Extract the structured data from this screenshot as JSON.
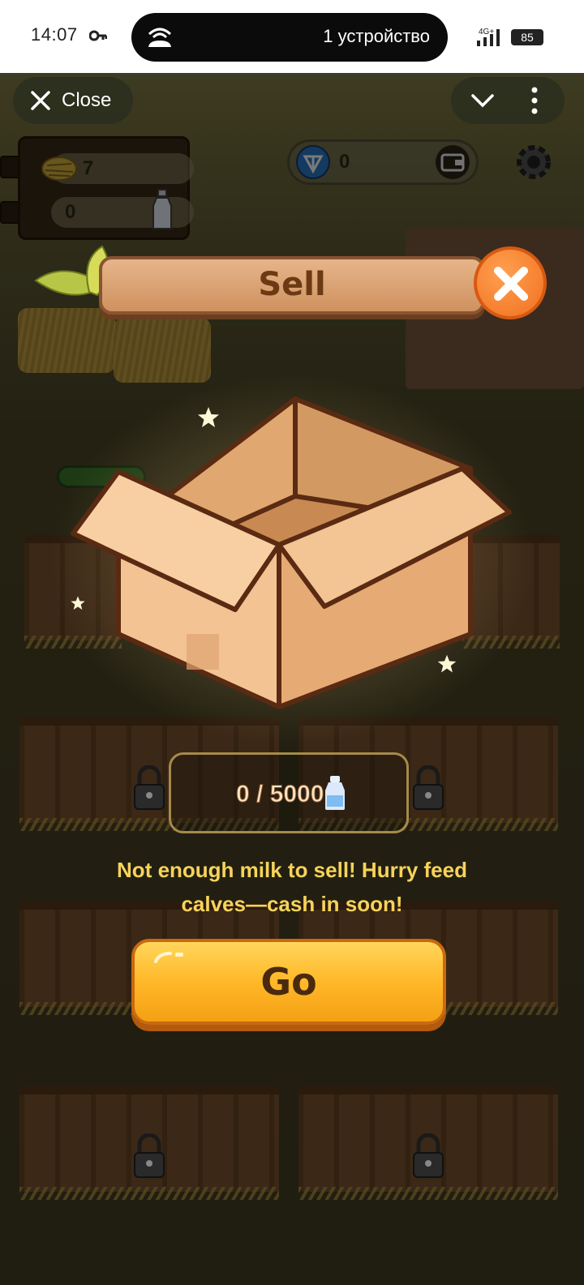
{
  "status_bar": {
    "time": "14:07",
    "island_text": "1 устройство",
    "network": "4G+",
    "battery": "85"
  },
  "mini_app": {
    "close_label": "Close"
  },
  "hud": {
    "hay_count": "7",
    "milk_count": "0",
    "ton_balance": "0"
  },
  "modal": {
    "title": "Sell",
    "progress": "0 / 5000",
    "message": "Not enough milk to sell! Hurry feed calves—cash in soon!",
    "go_label": "Go"
  },
  "colors": {
    "accent_orange": "#f5a014",
    "message_yellow": "#f6d35a",
    "sign_brown": "#6b3a14"
  },
  "icons": [
    "key-icon",
    "hotspot-icon",
    "signal-icon",
    "close-icon",
    "chevron-down-icon",
    "more-icon",
    "hay-icon",
    "bottle-icon",
    "ton-icon",
    "wallet-icon",
    "gear-icon",
    "lock-icon",
    "star-icon"
  ]
}
